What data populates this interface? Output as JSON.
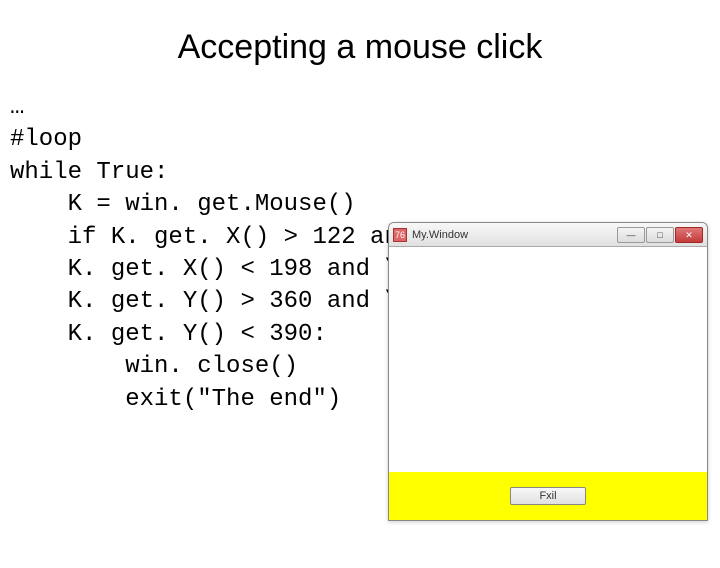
{
  "title": "Accepting a mouse click",
  "code": "…\n#loop\nwhile True:\n    K = win. get.Mouse()\n    if K. get. X() > 122 and \\\n    K. get. X() < 198 and \\\n    K. get. Y() > 360 and \\\n    K. get. Y() < 390:\n        win. close()\n        exit(\"The end\")",
  "window": {
    "icon_text": "76",
    "title": "My.Window",
    "min": "—",
    "max": "□",
    "close": "✕",
    "button_label": "Fxil"
  }
}
